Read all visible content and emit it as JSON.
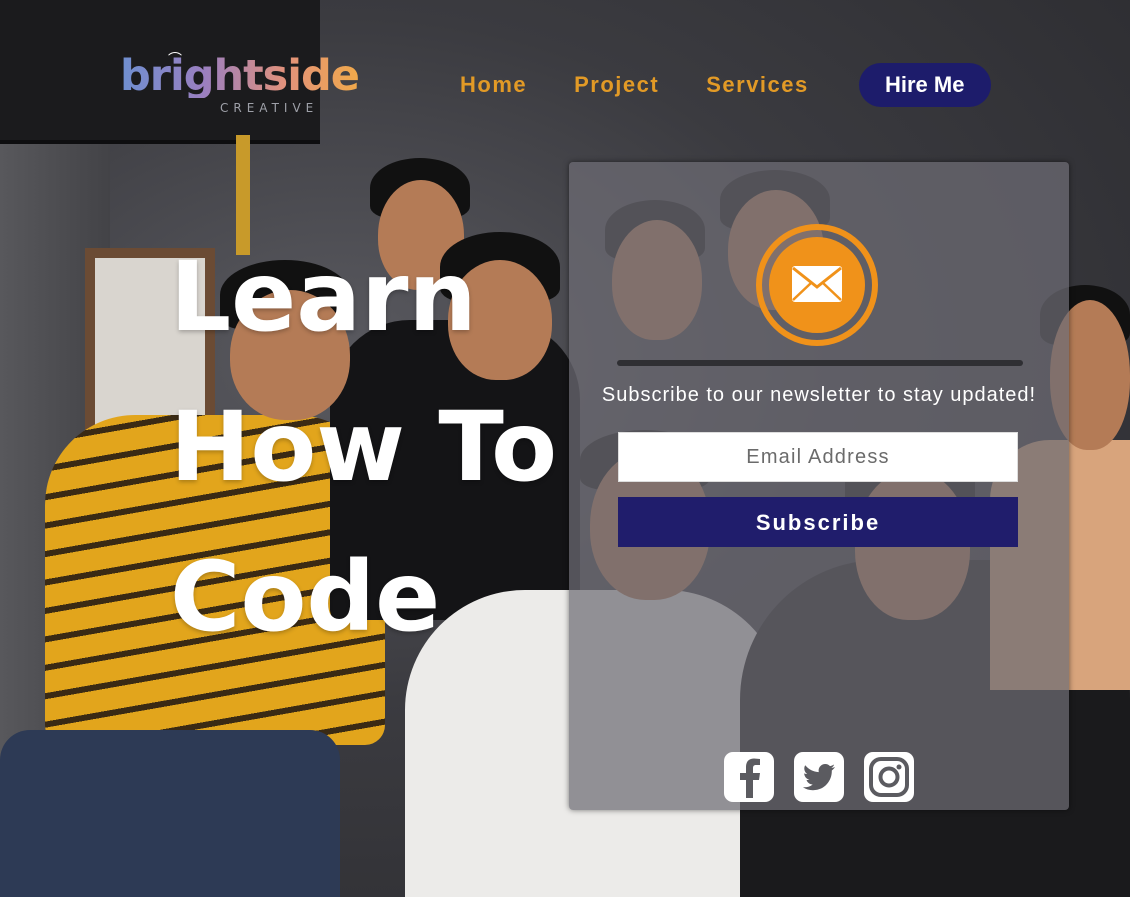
{
  "header": {
    "logo_word": "brightside",
    "logo_sub": "CREATIVE",
    "nav": [
      {
        "label": "Home"
      },
      {
        "label": "Project"
      },
      {
        "label": "Services"
      }
    ],
    "cta_label": "Hire Me"
  },
  "hero": {
    "lines": [
      "Learn",
      "How To",
      "Code"
    ]
  },
  "newsletter": {
    "tagline": "Subscribe to our newsletter to stay updated!",
    "email_placeholder": "Email Address",
    "button_label": "Subscribe",
    "icon": "mail-icon"
  },
  "social": [
    {
      "name": "facebook-icon"
    },
    {
      "name": "twitter-icon"
    },
    {
      "name": "instagram-icon"
    }
  ],
  "colors": {
    "nav_link": "#e29a26",
    "cta_bg": "#1d1c6b",
    "button_bg": "#201d6c",
    "mail_accent": "#f0921a"
  }
}
